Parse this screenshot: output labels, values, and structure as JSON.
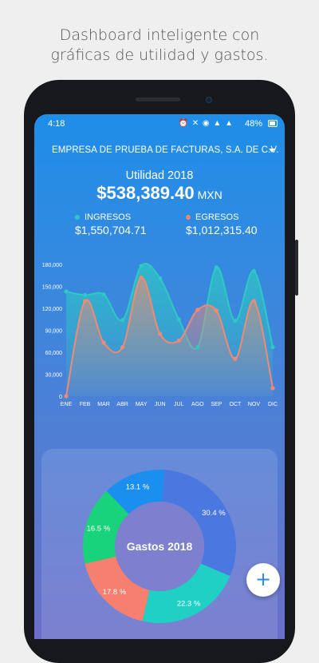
{
  "caption": {
    "line1": "Dashboard inteligente con",
    "line2": "gráficas de utilidad y gastos."
  },
  "status_bar": {
    "time": "4:18",
    "icons": "⏰ ✕ ◉ ▲ ▲",
    "battery": "48%"
  },
  "header": {
    "company": "EMPRESA DE PRUEBA DE FACTURAS, S.A. DE C.V."
  },
  "utility": {
    "label": "Utilidad 2018",
    "amount": "$538,389.40",
    "currency": "MXN"
  },
  "legend": {
    "ingresos_label": "INGRESOS",
    "ingresos_amount": "$1,550,704.71",
    "egresos_label": "EGRESOS",
    "egresos_amount": "$1,012,315.40"
  },
  "colors": {
    "ingresos": "#2ec9c2",
    "egresos": "#f08a73",
    "donut": [
      "#4a78e0",
      "#1fd0c4",
      "#f77f6f",
      "#19d37a",
      "#1b8ff0"
    ]
  },
  "chart_data": [
    {
      "type": "line",
      "categories": [
        "ENE",
        "FEB",
        "MAR",
        "ABR",
        "MAY",
        "JUN",
        "JUL",
        "AGO",
        "SEP",
        "OCT",
        "NOV",
        "DIC"
      ],
      "ylim": [
        0,
        180000
      ],
      "yticks": [
        "0",
        "30,000",
        "60,000",
        "90,000",
        "120,000",
        "150,000",
        "180,000"
      ],
      "ytick_values": [
        0,
        30000,
        60000,
        90000,
        120000,
        150000,
        180000
      ],
      "series": [
        {
          "name": "INGRESOS",
          "values": [
            143000,
            138000,
            139000,
            104000,
            178000,
            161000,
            105000,
            67000,
            176000,
            103000,
            171000,
            67000
          ]
        },
        {
          "name": "EGRESOS",
          "values": [
            0,
            130000,
            73000,
            67000,
            162000,
            85000,
            76000,
            118000,
            117000,
            51000,
            130000,
            11000
          ]
        }
      ]
    },
    {
      "type": "pie",
      "title": "Gastos 2018",
      "labels": [
        "30.4 %",
        "22.3 %",
        "17.8 %",
        "16.5 %",
        "13.1 %"
      ],
      "values": [
        30.4,
        22.3,
        17.8,
        16.5,
        13.1
      ]
    }
  ]
}
